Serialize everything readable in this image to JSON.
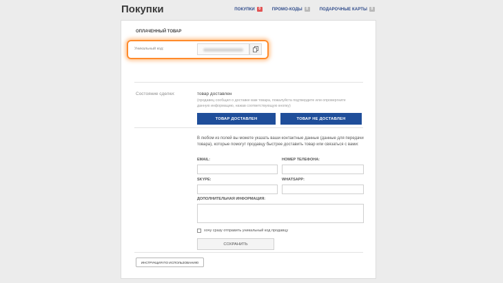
{
  "page": {
    "title": "Покупки"
  },
  "nav": [
    {
      "label": "ПОКУПКИ",
      "badge": "0",
      "active": true
    },
    {
      "label": "ПРОМО-КОДЫ",
      "badge": "0"
    },
    {
      "label": "ПОДАРОЧНЫЕ КАРТЫ",
      "badge": "0"
    }
  ],
  "paid": {
    "section_title": "ОПЛАЧЕННЫЙ ТОВАР",
    "code_label": "Уникальный код:"
  },
  "deal": {
    "status_label": "Состояние сделки:",
    "delivered_title": "товар доставлен",
    "delivered_desc": "(продавец сообщил о доставке вам товара, пожалуйста подтвердите или опровергните данную информацию, нажав соответствующую кнопку)",
    "btn_delivered": "ТОВАР ДОСТАВЛЕН",
    "btn_not_delivered": "ТОВАР НЕ ДОСТАВЛЕН"
  },
  "contact": {
    "desc": "В любом из полей вы можете указать ваши контактные данные (данные для передачи товара), которые помогут продавцу быстрее доставить товар или связаться с вами:",
    "email_label": "EMAIL:",
    "phone_label": "НОМЕР ТЕЛЕФОНА:",
    "skype_label": "SKYPE:",
    "whatsapp_label": "WHATSAPP:",
    "extra_label": "ДОПОЛНИТЕЛЬНАЯ ИНФОРМАЦИЯ:",
    "checkbox_label": "хочу сразу отправить уникальный код продавцу",
    "save_label": "СОХРАНИТЬ"
  },
  "instructions": {
    "label": "ИНСТРУКЦИЯ ПО ИСПОЛЬЗОВАНИЮ"
  },
  "colors": {
    "primary": "#1f4e9a",
    "highlight": "#ff8a2a",
    "badge_active": "#e25454"
  }
}
